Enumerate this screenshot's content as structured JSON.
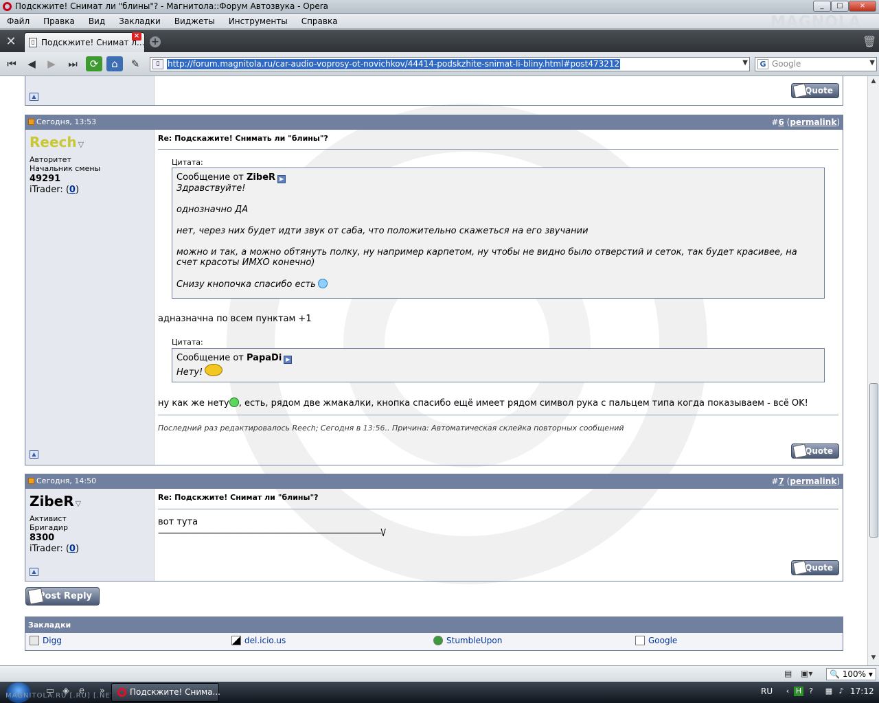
{
  "window": {
    "title": "Подскжите! Снимат ли \"блины\"? - Магнитола::Форум Автозвука - Opera",
    "min": "_",
    "max": "□",
    "close": "×"
  },
  "menu": {
    "items": [
      "Файл",
      "Правка",
      "Вид",
      "Закладки",
      "Виджеты",
      "Инструменты",
      "Справка"
    ],
    "brand": "MAGNOLA"
  },
  "tabs": {
    "active_label": "Подскжите! Снимат л...",
    "close": "×",
    "new": "+"
  },
  "address": {
    "url": "http://forum.magnitola.ru/car-audio-voprosy-ot-novichkov/44414-podskzhite-snimat-li-bliny.html#post473212",
    "search_engine": "G",
    "search_placeholder": "Google"
  },
  "quote_label": "Quote",
  "posts": [
    {
      "date": "Сегодня, 13:53",
      "num_prefix": "#",
      "num": "6",
      "permalink": "permalink",
      "user": {
        "name": "Reech",
        "name_color": "#c8c832",
        "rank": "Авторитет",
        "title": "Начальник смены",
        "count": "49291",
        "itrader_label": "iTrader: (",
        "itrader_value": "0",
        "itrader_close": ")"
      },
      "subject": "Re: Подскажите! Снимать ли \"блины\"?",
      "quote1": {
        "label": "Цитата:",
        "from_prefix": "Сообщение от",
        "from": "ZibeR",
        "lines": [
          "Здравствуйте!",
          "однозначно ДА",
          "нет, через них будет идти звук от саба, что положительно скажеться на его звучании",
          "можно и так, а можно обтянуть полку, ну например карпетом, ну чтобы не видно было отверстий и сеток, так будет красивее, на",
          "счет красоты ИМХО конечно)",
          "Снизу кнопочка спасибо есть"
        ]
      },
      "reply1": "адназначна по всем пунктам +1",
      "quote2": {
        "label": "Цитата:",
        "from_prefix": "Сообщение от",
        "from": "PapaDi",
        "line": "Нету!"
      },
      "reply2_a": "ну как же нету",
      "reply2_b": ", есть, рядом две жмакалки, кнопка спасибо ещё имеет рядом символ рука с пальцем типа когда показываем - всё OK!",
      "edit": {
        "prefix": "Последний раз редактировалось Reech; Сегодня в ",
        "time": "13:56",
        "suffix": ".. Причина: Автоматическая склейка повторных сообщений"
      }
    },
    {
      "date": "Сегодня, 14:50",
      "num_prefix": "#",
      "num": "7",
      "permalink": "permalink",
      "user": {
        "name": "ZibeR",
        "name_color": "#000000",
        "rank": "Активист",
        "title": "Бригадир",
        "count": "8300",
        "itrader_label": "iTrader: (",
        "itrader_value": "0",
        "itrader_close": ")"
      },
      "subject": "Re: Подскжите! Снимат ли \"блины\"?",
      "body1": "вот тута",
      "body2": "---------------------------------------------------------------------------------------------------------\\/"
    }
  ],
  "post_reply": "Post Reply",
  "bookmarks": {
    "title": "Закладки",
    "items": [
      "Digg",
      "del.icio.us",
      "StumbleUpon",
      "Google"
    ]
  },
  "status": {
    "zoom": "100%"
  },
  "taskbar": {
    "task_label": "Подскжите! Снима...",
    "lang": "RU",
    "clock": "17:12",
    "watermark": "MAGNITOLA.RU [.RU] [.NET]"
  },
  "colors": {
    "post_header": "#71809f",
    "left_panel": "#e5e8ee",
    "link": "#003399",
    "selection": "#316ac5"
  }
}
